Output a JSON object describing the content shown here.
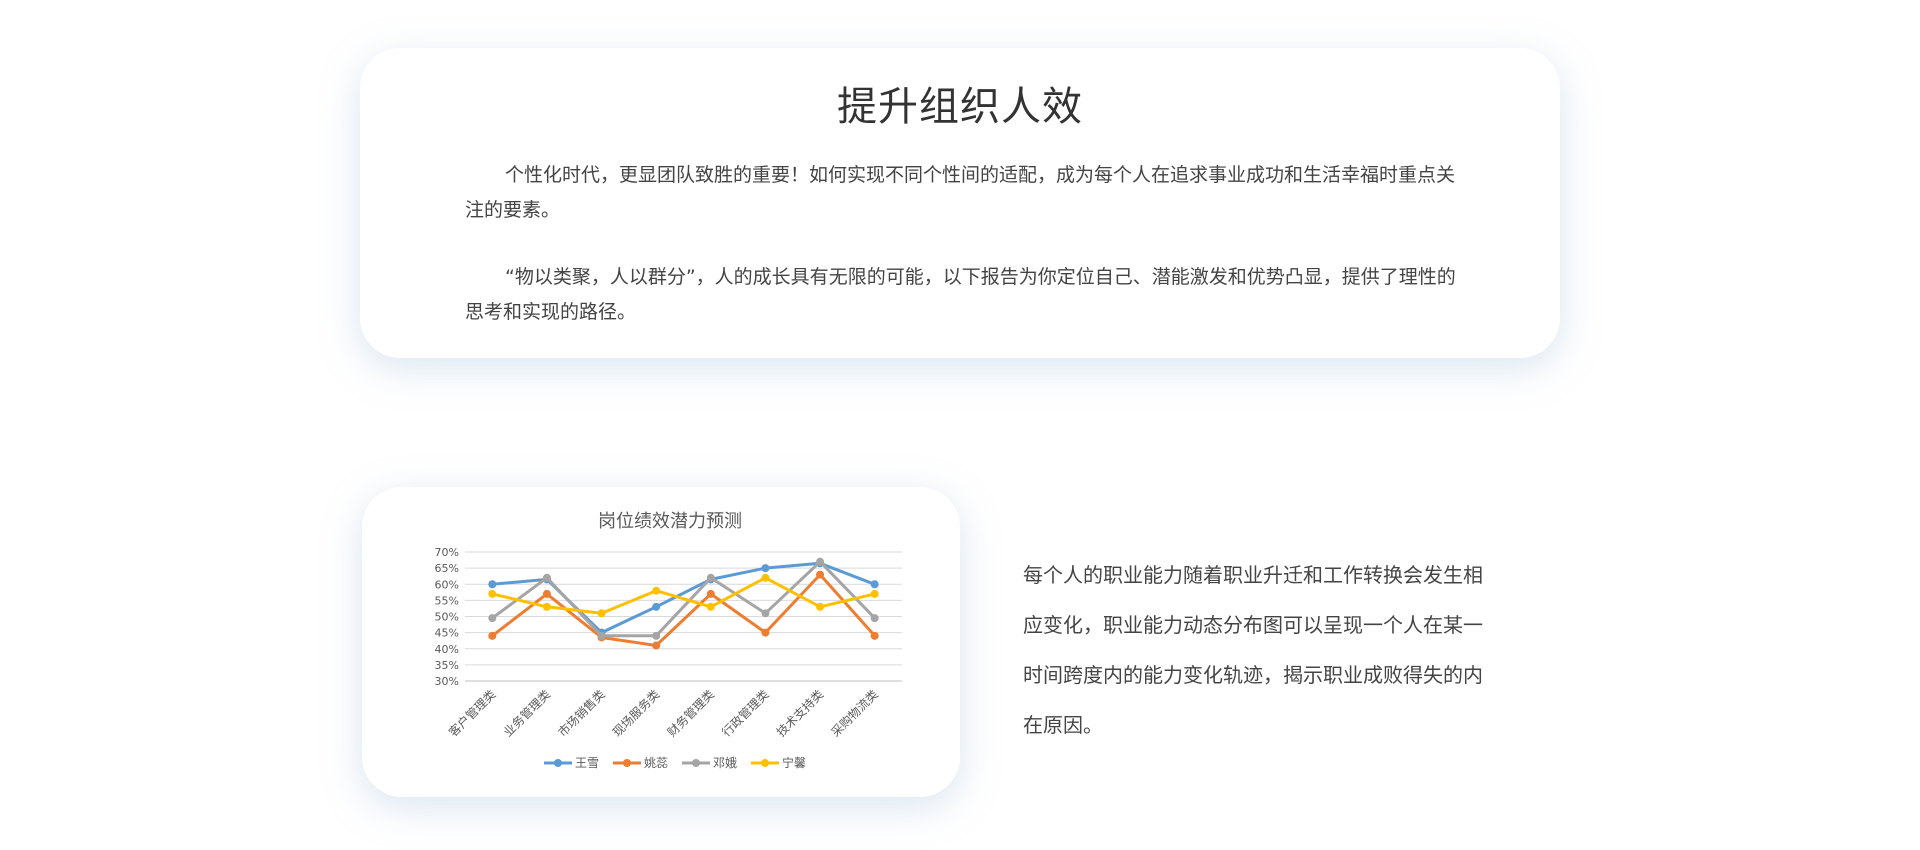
{
  "intro": {
    "title": "提升组织人效",
    "paragraph_1": "个性化时代，更显团队致胜的重要！如何实现不同个性间的适配，成为每个人在追求事业成功和生活幸福时重点关注的要素。",
    "paragraph_2": "“物以类聚，人以群分”，人的成长具有无限的可能，以下报告为你定位自己、潜能激发和优势凸显，提供了理性的思考和实现的路径。"
  },
  "side_text": "每个人的职业能力随着职业升迁和工作转换会发生相应变化，职业能力动态分布图可以呈现一个人在某一时间跨度内的能力变化轨迹，揭示职业成败得失的内在原因。",
  "chart_data": {
    "type": "line",
    "title": "岗位绩效潜力预测",
    "categories": [
      "客户管理类",
      "业务管理类",
      "市场销售类",
      "现场服务类",
      "财务管理类",
      "行政管理类",
      "技术支持类",
      "采购物流类"
    ],
    "y_ticks": [
      "30%",
      "35%",
      "40%",
      "45%",
      "50%",
      "55%",
      "60%",
      "65%",
      "70%"
    ],
    "ylim": [
      30,
      70
    ],
    "grid": true,
    "legend_position": "bottom",
    "series": [
      {
        "name": "王雪",
        "color": "#5B9BD5",
        "values": [
          60,
          61.5,
          45,
          53,
          61.5,
          65,
          66.5,
          60
        ]
      },
      {
        "name": "姚蕊",
        "color": "#ED7D31",
        "values": [
          44,
          57,
          43.5,
          41,
          57,
          45,
          63,
          44
        ]
      },
      {
        "name": "邓娥",
        "color": "#A5A5A5",
        "values": [
          49.5,
          62,
          44,
          44,
          62,
          51,
          67,
          49.5
        ]
      },
      {
        "name": "宁馨",
        "color": "#FFC000",
        "values": [
          57,
          53,
          51,
          58,
          53,
          62,
          53,
          57
        ]
      }
    ]
  }
}
